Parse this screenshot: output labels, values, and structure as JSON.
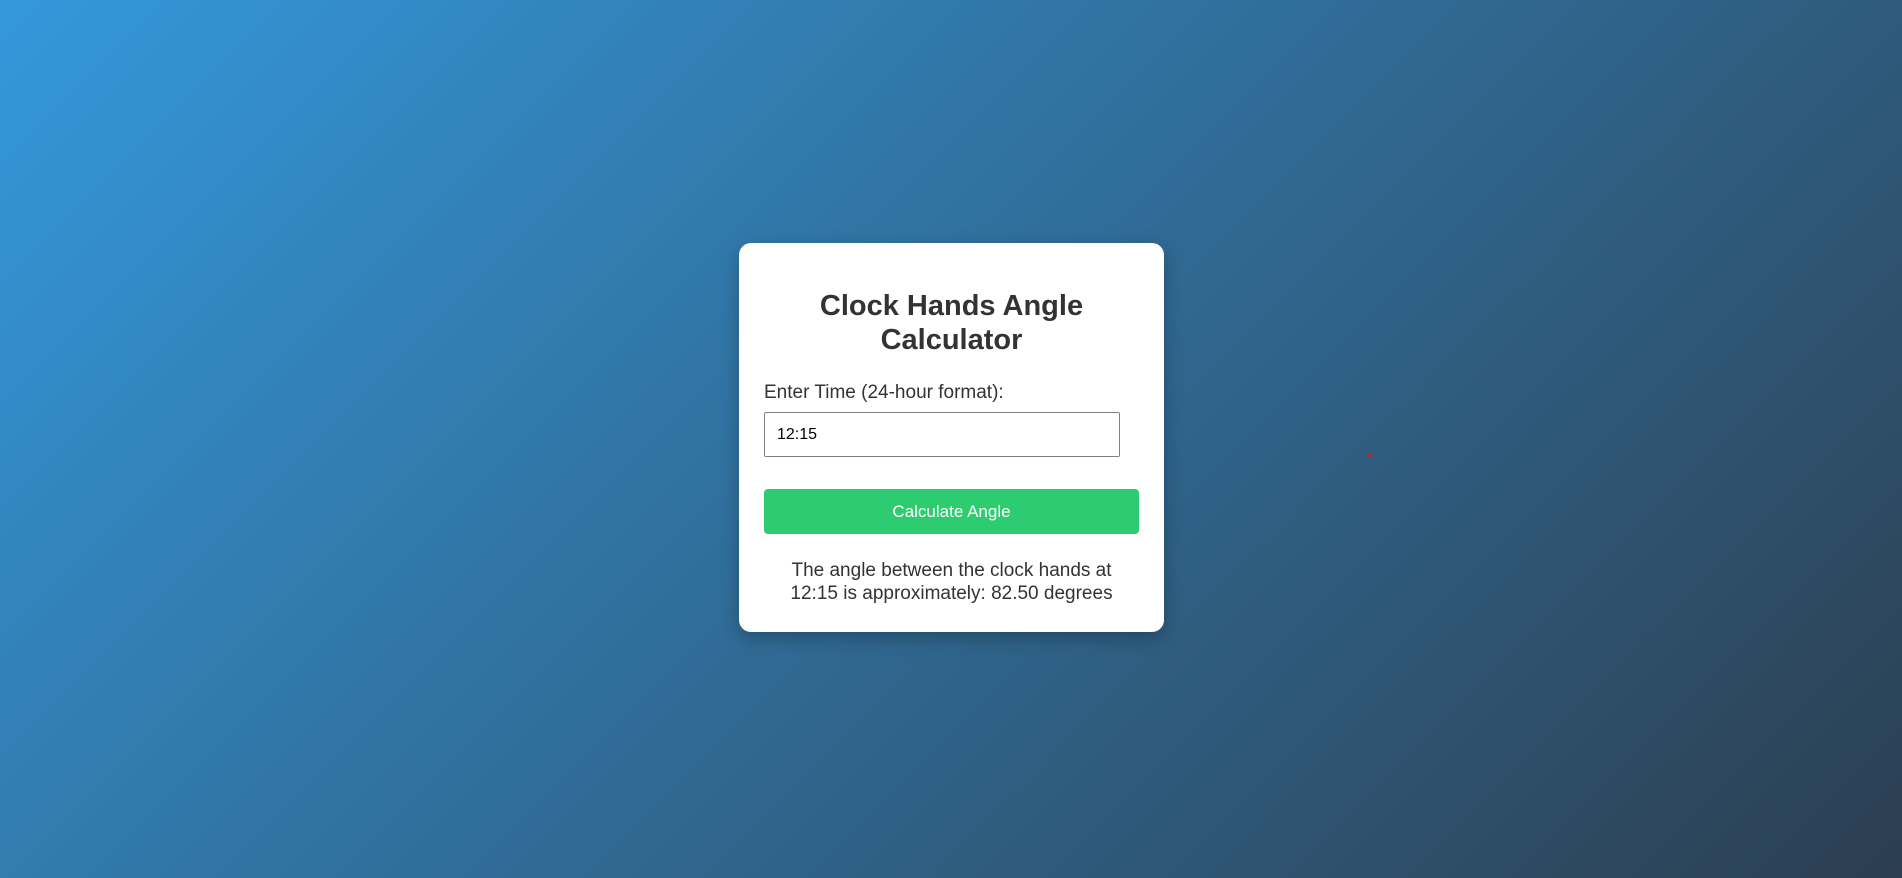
{
  "calculator": {
    "title": "Clock Hands Angle Calculator",
    "input_label": "Enter Time (24-hour format):",
    "time_value": "12:15",
    "button_label": "Calculate Angle",
    "result_text": "The angle between the clock hands at 12:15 is approximately: 82.50 degrees"
  },
  "colors": {
    "background_start": "#3498db",
    "background_end": "#2c3e50",
    "button": "#2ecc71",
    "card": "#ffffff",
    "text": "#333333"
  }
}
